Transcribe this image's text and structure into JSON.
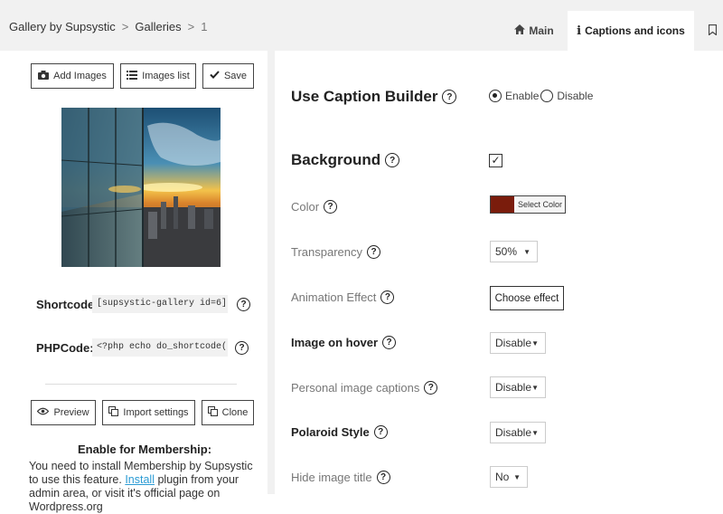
{
  "breadcrumb": {
    "root": "Gallery by Supsystic",
    "separator": ">",
    "section": "Galleries",
    "current": "1"
  },
  "tabs": {
    "main": {
      "label": "Main",
      "icon": "home-icon"
    },
    "captions": {
      "label": "Captions and icons",
      "icon": "info-icon"
    }
  },
  "left": {
    "buttons": {
      "add_images": "Add Images",
      "images_list": "Images list",
      "save": "Save",
      "preview": "Preview",
      "import_settings": "Import settings",
      "clone": "Clone"
    },
    "shortcode": {
      "label": "Shortcode:",
      "value": "[supsystic-gallery id=6]"
    },
    "phpcode": {
      "label": "PHPCode:",
      "value": "<?php echo do_shortcode('[s"
    },
    "membership": {
      "title": "Enable for Membership:",
      "text_before": "You need to install Membership by Supsystic to use this feature.",
      "link": "Install",
      "text_after": "plugin from your admin area, or visit it's official page on Wordpress.org"
    }
  },
  "options": {
    "caption_builder": {
      "label": "Use Caption Builder",
      "enable": "Enable",
      "disable": "Disable",
      "selected": "Enable"
    },
    "background": {
      "label": "Background",
      "checked": true
    },
    "color": {
      "label": "Color",
      "button": "Select Color",
      "value": "#7a1c0c"
    },
    "transparency": {
      "label": "Transparency",
      "value": "50%"
    },
    "animation": {
      "label": "Animation Effect",
      "button": "Choose effect"
    },
    "image_on_hover": {
      "label": "Image on hover",
      "value": "Disable"
    },
    "personal_captions": {
      "label": "Personal image captions",
      "value": "Disable"
    },
    "polaroid": {
      "label": "Polaroid Style",
      "value": "Disable"
    },
    "hide_title": {
      "label": "Hide image title",
      "value": "No"
    }
  }
}
